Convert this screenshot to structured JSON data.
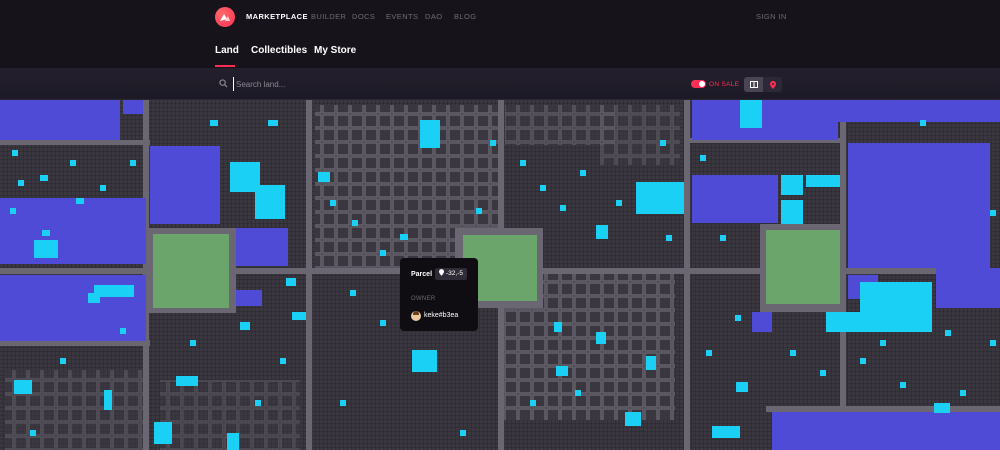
{
  "header": {
    "brand": "MARKETPLACE",
    "nav": [
      "BUILDER",
      "DOCS",
      "EVENTS",
      "DAO",
      "BLOG"
    ],
    "signin": "SIGN IN"
  },
  "tabs": [
    "Land",
    "Collectibles",
    "My Store"
  ],
  "search": {
    "placeholder": "Search land..."
  },
  "filters": {
    "on_sale_label": "ON SALE"
  },
  "tooltip": {
    "title": "Parcel",
    "coordinates": "-32,-5",
    "owner_label": "OWNER",
    "owner_name": "keke#b3ea"
  },
  "colors": {
    "accent": "#ff2d55",
    "plaza": "#6ca56c",
    "district": "#4f4bd6",
    "on_sale": "#1ad1f5",
    "road": "#6b6772",
    "parcel": "#3a3740"
  },
  "icons": {
    "search": "search-icon",
    "grid_view": "grid-icon",
    "map_view": "pin-icon",
    "coordinates": "pin-icon"
  }
}
